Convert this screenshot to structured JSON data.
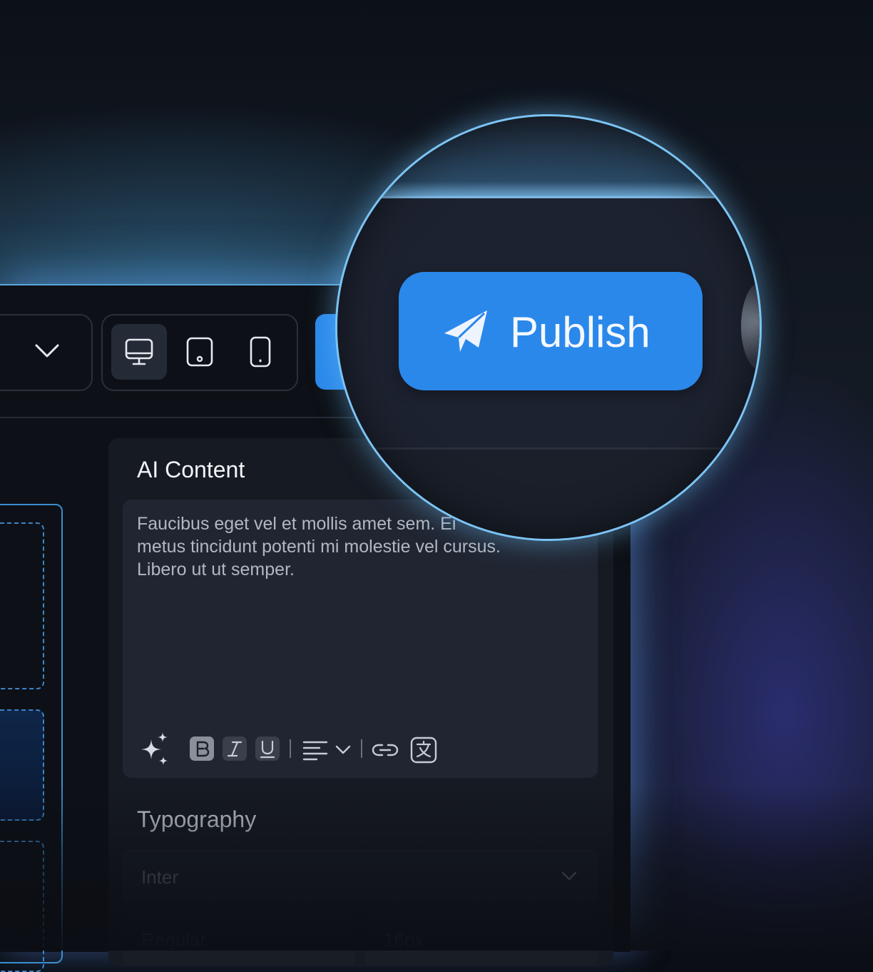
{
  "toolbar": {
    "devices": [
      {
        "icon": "desktop-icon",
        "active": true
      },
      {
        "icon": "tablet-icon",
        "active": false
      },
      {
        "icon": "mobile-icon",
        "active": false
      }
    ],
    "publish_label": "Publish"
  },
  "panel": {
    "title": "AI Content",
    "editor_text": "Faucibus eget vel et mollis amet sem. Ei\nmetus tincidunt potenti mi molestie vel cursus.\nLibero ut ut semper.",
    "editor_tools": [
      "sparkles-icon",
      "bold-icon",
      "italic-icon",
      "underline-icon",
      "align-left-icon",
      "chevron-down-icon",
      "link-icon",
      "translate-icon"
    ]
  },
  "typography": {
    "title": "Typography",
    "font_family": "Inter",
    "font_weight": "Regular",
    "font_size": "16px"
  },
  "colors": {
    "accent": "#2a88ea",
    "background": "#0d1016",
    "panel": "#161a22"
  }
}
